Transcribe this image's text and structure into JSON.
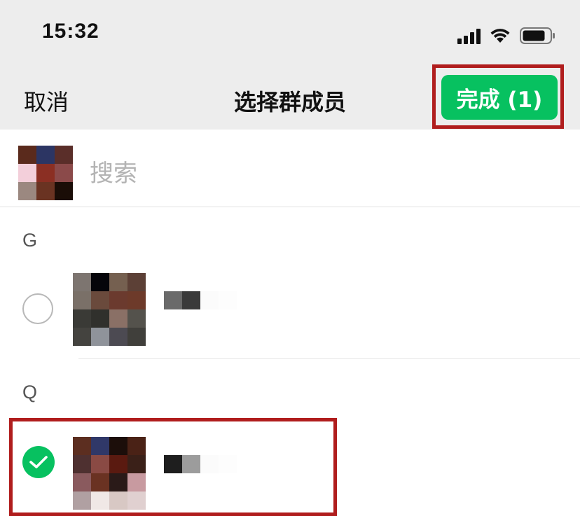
{
  "status_bar": {
    "time": "15:32"
  },
  "nav": {
    "cancel_label": "取消",
    "title": "选择群成员",
    "done_label": "完成 (1)"
  },
  "search": {
    "placeholder": "搜索"
  },
  "sections": [
    {
      "letter": "G",
      "contacts": [
        {
          "selected": false,
          "name": ""
        }
      ]
    },
    {
      "letter": "Q",
      "contacts": [
        {
          "selected": true,
          "name": ""
        }
      ]
    }
  ],
  "colors": {
    "accent_green": "#07c160",
    "highlight_red": "#b01d1d",
    "bar_bg": "#ededed"
  },
  "icons": {
    "signal": "cellular-signal-icon",
    "wifi": "wifi-icon",
    "battery": "battery-icon",
    "check": "checkmark-icon"
  }
}
